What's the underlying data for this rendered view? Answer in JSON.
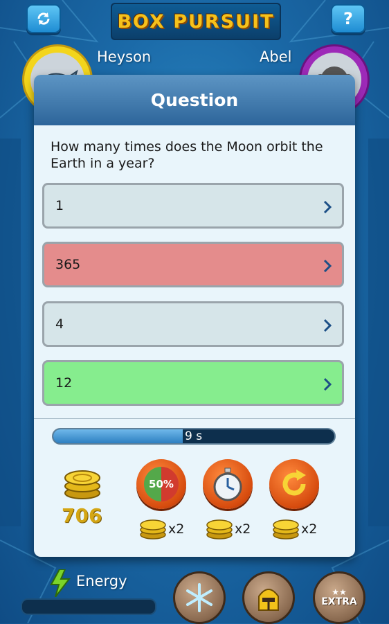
{
  "header": {
    "refresh_icon": "refresh-icon",
    "help_label": "?",
    "logo_text": "BOX PURSUIT"
  },
  "players": {
    "left": {
      "name": "Heyson",
      "avatar_icon": "shark-icon"
    },
    "right": {
      "name": "Abel",
      "avatar_icon": "monkey-icon"
    }
  },
  "modal": {
    "title": "Question",
    "question": "How many times does the Moon orbit the Earth in a year?",
    "answers": [
      {
        "label": "1",
        "state": "neutral"
      },
      {
        "label": "365",
        "state": "wrong"
      },
      {
        "label": "4",
        "state": "neutral"
      },
      {
        "label": "12",
        "state": "correct"
      }
    ],
    "timer": {
      "text": "9 s",
      "progress": 0.46
    },
    "coins": {
      "total": "706"
    },
    "powerups": [
      {
        "name": "fifty-fifty",
        "label": "50%",
        "cost": "x2"
      },
      {
        "name": "extra-time",
        "icon": "stopwatch-icon",
        "cost": "x2"
      },
      {
        "name": "retry",
        "icon": "retry-icon",
        "cost": "x2"
      }
    ]
  },
  "footer": {
    "energy_label": "Energy",
    "extra_label": "EXTRA",
    "buttons": [
      "freeze-icon",
      "helmet-icon",
      "extra-stars-icon"
    ]
  },
  "colors": {
    "neutral": "#d6e5e9",
    "wrong": "#e48c8c",
    "correct": "#86ed8e",
    "accent_blue": "#2d659a",
    "coin_gold": "#d4a614"
  }
}
